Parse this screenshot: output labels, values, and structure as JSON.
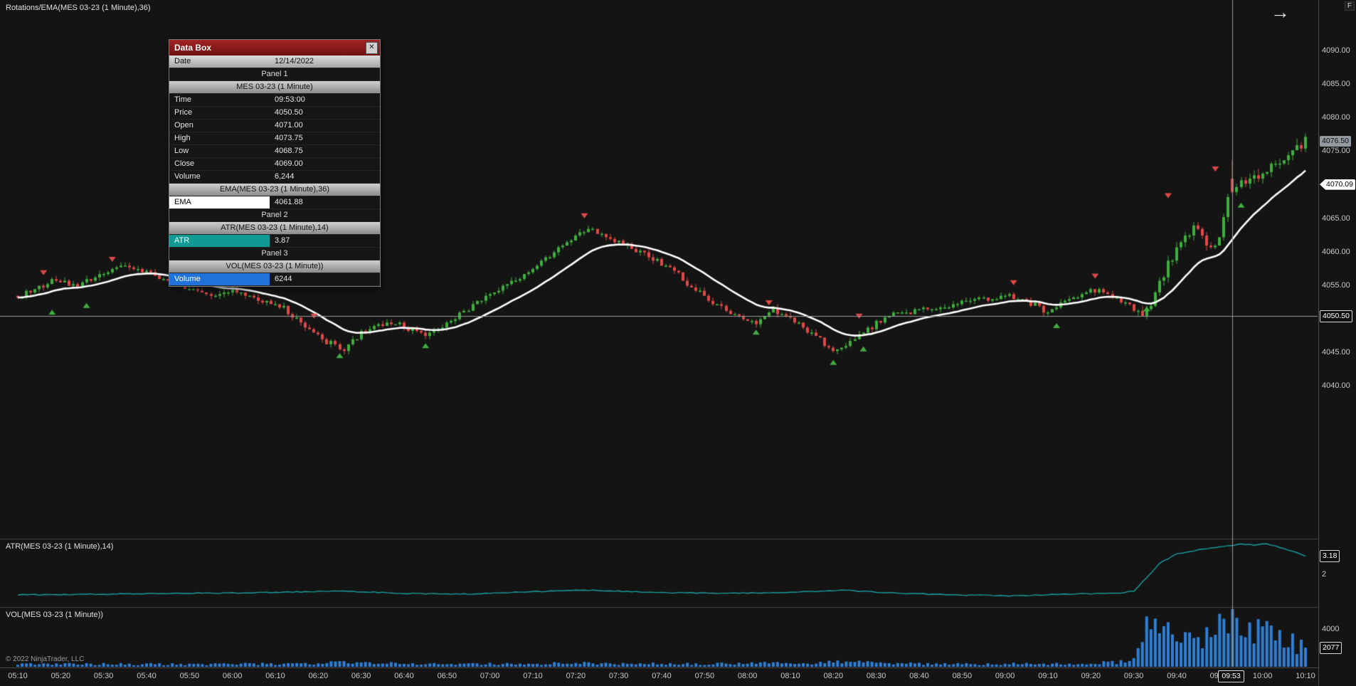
{
  "window": {
    "title": "Rotations/EMA(MES 03-23 (1 Minute),36)",
    "top_right_label": "F",
    "copyright": "© 2022 NinjaTrader, LLC"
  },
  "icons": {
    "close": "✕",
    "arrow_annotation": "→"
  },
  "panels": {
    "atr": {
      "label": "ATR(MES 03-23 (1 Minute),14)"
    },
    "vol": {
      "label": "VOL(MES 03-23 (1 Minute))"
    }
  },
  "data_box": {
    "title": "Data Box",
    "rows": [
      {
        "type": "date",
        "label": "Date",
        "value": "12/14/2022"
      },
      {
        "type": "panel",
        "label": "Panel 1"
      },
      {
        "type": "header",
        "label": "MES 03-23 (1 Minute)"
      },
      {
        "type": "field",
        "label": "Time",
        "value": "09:53:00"
      },
      {
        "type": "field",
        "label": "Price",
        "value": "4050.50"
      },
      {
        "type": "field",
        "label": "Open",
        "value": "4071.00"
      },
      {
        "type": "field",
        "label": "High",
        "value": "4073.75"
      },
      {
        "type": "field",
        "label": "Low",
        "value": "4068.75"
      },
      {
        "type": "field",
        "label": "Close",
        "value": "4069.00"
      },
      {
        "type": "field",
        "label": "Volume",
        "value": "6,244"
      },
      {
        "type": "header",
        "label": "EMA(MES 03-23 (1 Minute),36)"
      },
      {
        "type": "plot",
        "label": "EMA",
        "value": "4061.88",
        "swatch": "#ffffff",
        "text": "#000000"
      },
      {
        "type": "panel",
        "label": "Panel 2"
      },
      {
        "type": "header",
        "label": "ATR(MES 03-23 (1 Minute),14)"
      },
      {
        "type": "plot",
        "label": "ATR",
        "value": "3.87",
        "swatch": "#0f9b94",
        "text": "#ffffff"
      },
      {
        "type": "panel",
        "label": "Panel 3"
      },
      {
        "type": "header",
        "label": "VOL(MES 03-23 (1 Minute))"
      },
      {
        "type": "plot",
        "label": "Volume",
        "value": "6244",
        "swatch": "#1f72d9",
        "text": "#ffffff"
      }
    ]
  },
  "axis": {
    "price_labels": [
      {
        "value": 4090,
        "label": "4090.00"
      },
      {
        "value": 4085,
        "label": "4085.00"
      },
      {
        "value": 4080,
        "label": "4080.00"
      },
      {
        "value": 4075,
        "label": "4075.00"
      },
      {
        "value": 4065,
        "label": "4065.00"
      },
      {
        "value": 4060,
        "label": "4060.00"
      },
      {
        "value": 4055,
        "label": "4055.00"
      },
      {
        "value": 4045,
        "label": "4045.00"
      },
      {
        "value": 4040,
        "label": "4040.00"
      }
    ],
    "atr_labels": [
      {
        "value": 2,
        "label": "2"
      }
    ],
    "vol_labels": [
      {
        "value": 4000,
        "label": "4000"
      }
    ],
    "time_labels": [
      {
        "t": 0,
        "label": "05:10"
      },
      {
        "t": 10,
        "label": "05:20"
      },
      {
        "t": 20,
        "label": "05:30"
      },
      {
        "t": 30,
        "label": "05:40"
      },
      {
        "t": 40,
        "label": "05:50"
      },
      {
        "t": 50,
        "label": "06:00"
      },
      {
        "t": 60,
        "label": "06:10"
      },
      {
        "t": 70,
        "label": "06:20"
      },
      {
        "t": 80,
        "label": "06:30"
      },
      {
        "t": 90,
        "label": "06:40"
      },
      {
        "t": 100,
        "label": "06:50"
      },
      {
        "t": 110,
        "label": "07:00"
      },
      {
        "t": 120,
        "label": "07:10"
      },
      {
        "t": 130,
        "label": "07:20"
      },
      {
        "t": 140,
        "label": "07:30"
      },
      {
        "t": 150,
        "label": "07:40"
      },
      {
        "t": 160,
        "label": "07:50"
      },
      {
        "t": 170,
        "label": "08:00"
      },
      {
        "t": 180,
        "label": "08:10"
      },
      {
        "t": 190,
        "label": "08:20"
      },
      {
        "t": 200,
        "label": "08:30"
      },
      {
        "t": 210,
        "label": "08:40"
      },
      {
        "t": 220,
        "label": "08:50"
      },
      {
        "t": 230,
        "label": "09:00"
      },
      {
        "t": 240,
        "label": "09:10"
      },
      {
        "t": 250,
        "label": "09:20"
      },
      {
        "t": 260,
        "label": "09:30"
      },
      {
        "t": 270,
        "label": "09:40"
      },
      {
        "t": 280,
        "label": "09:50"
      },
      {
        "t": 290,
        "label": "10:00"
      },
      {
        "t": 300,
        "label": "10:10"
      }
    ],
    "markers": {
      "last_price": {
        "value": 4076.5,
        "label": "4076.50"
      },
      "ema": {
        "value": 4070.09,
        "label": "4070.09"
      },
      "crosshair_price": {
        "value": 4050.5,
        "label": "4050.50"
      },
      "atr": {
        "value": 3.18,
        "label": "3.18"
      },
      "volume": {
        "value": 2077,
        "label": "2077"
      },
      "crosshair_time": {
        "t": 283,
        "label": "09:53"
      }
    }
  },
  "chart_data": {
    "type": "candlestick",
    "instrument": "MES 03-23 (1 Minute)",
    "session_start": "05:10",
    "session_end": "10:10",
    "minutes": 300,
    "candle_up_color": "#3fae3f",
    "candle_down_color": "#e04848",
    "crosshair": {
      "t": 283,
      "price": 4050.5,
      "time_label": "09:53"
    },
    "main": {
      "ylim": [
        4017.2,
        4097.7
      ],
      "close_waypoints": [
        [
          0,
          4053.5
        ],
        [
          4,
          4054.5
        ],
        [
          9,
          4056.0
        ],
        [
          13,
          4054.8
        ],
        [
          18,
          4056.2
        ],
        [
          24,
          4058.0
        ],
        [
          28,
          4057.5
        ],
        [
          34,
          4056.0
        ],
        [
          40,
          4054.5
        ],
        [
          44,
          4053.5
        ],
        [
          50,
          4054.5
        ],
        [
          56,
          4053.0
        ],
        [
          60,
          4052.5
        ],
        [
          66,
          4049.5
        ],
        [
          72,
          4046.5
        ],
        [
          76,
          4045.5
        ],
        [
          80,
          4048.0
        ],
        [
          86,
          4049.5
        ],
        [
          90,
          4049.0
        ],
        [
          95,
          4047.5
        ],
        [
          100,
          4049.5
        ],
        [
          106,
          4052.0
        ],
        [
          112,
          4054.5
        ],
        [
          118,
          4056.5
        ],
        [
          124,
          4059.5
        ],
        [
          130,
          4062.5
        ],
        [
          133,
          4063.5
        ],
        [
          137,
          4062.0
        ],
        [
          142,
          4061.0
        ],
        [
          147,
          4059.5
        ],
        [
          152,
          4057.5
        ],
        [
          157,
          4055.0
        ],
        [
          162,
          4052.5
        ],
        [
          167,
          4050.5
        ],
        [
          172,
          4049.5
        ],
        [
          176,
          4051.5
        ],
        [
          181,
          4050.0
        ],
        [
          186,
          4047.5
        ],
        [
          190,
          4045.0
        ],
        [
          194,
          4046.5
        ],
        [
          198,
          4048.5
        ],
        [
          203,
          4050.5
        ],
        [
          208,
          4051.0
        ],
        [
          214,
          4051.5
        ],
        [
          220,
          4052.5
        ],
        [
          226,
          4053.0
        ],
        [
          231,
          4053.5
        ],
        [
          236,
          4052.5
        ],
        [
          240,
          4051.0
        ],
        [
          245,
          4053.0
        ],
        [
          250,
          4054.5
        ],
        [
          255,
          4053.5
        ],
        [
          259,
          4052.0
        ],
        [
          262,
          4050.0
        ],
        [
          265,
          4054.0
        ],
        [
          268,
          4058.0
        ],
        [
          271,
          4061.5
        ],
        [
          274,
          4064.0
        ],
        [
          276,
          4062.5
        ],
        [
          278,
          4060.5
        ],
        [
          280,
          4062.5
        ],
        [
          282,
          4068.0
        ],
        [
          284,
          4070.0
        ],
        [
          287,
          4071.0
        ],
        [
          290,
          4072.0
        ],
        [
          293,
          4073.0
        ],
        [
          296,
          4074.5
        ],
        [
          298,
          4075.5
        ],
        [
          300,
          4076.5
        ]
      ],
      "crosshair_bar": {
        "t": 283,
        "open": 4071.0,
        "high": 4073.75,
        "low": 4068.75,
        "close": 4069.0,
        "volume": 6244
      }
    },
    "ema": {
      "period": 36,
      "draw_period": 18,
      "color": "#ffffff",
      "last_value": 4070.09
    },
    "atr": {
      "period": 14,
      "ylim": [
        0,
        4.2
      ],
      "color": "#1a9e9e",
      "last_value": 3.18,
      "anchors": [
        [
          0,
          0.75
        ],
        [
          20,
          0.8
        ],
        [
          40,
          0.85
        ],
        [
          60,
          0.9
        ],
        [
          75,
          1.0
        ],
        [
          90,
          0.85
        ],
        [
          105,
          0.8
        ],
        [
          120,
          0.95
        ],
        [
          133,
          1.05
        ],
        [
          150,
          0.9
        ],
        [
          165,
          0.85
        ],
        [
          180,
          0.9
        ],
        [
          192,
          1.05
        ],
        [
          205,
          0.85
        ],
        [
          220,
          0.75
        ],
        [
          232,
          0.7
        ],
        [
          245,
          0.8
        ],
        [
          256,
          0.85
        ],
        [
          260,
          1.0
        ],
        [
          263,
          1.8
        ],
        [
          266,
          2.7
        ],
        [
          270,
          3.3
        ],
        [
          274,
          3.5
        ],
        [
          278,
          3.65
        ],
        [
          282,
          3.8
        ],
        [
          285,
          3.9
        ],
        [
          288,
          3.85
        ],
        [
          291,
          3.95
        ],
        [
          294,
          3.7
        ],
        [
          297,
          3.45
        ],
        [
          300,
          3.18
        ]
      ]
    },
    "volume": {
      "ylim": [
        0,
        6400
      ],
      "color": "#2f7fd6",
      "last_value": 2077,
      "anchors": [
        [
          0,
          280
        ],
        [
          20,
          300
        ],
        [
          40,
          260
        ],
        [
          60,
          320
        ],
        [
          75,
          430
        ],
        [
          90,
          330
        ],
        [
          110,
          300
        ],
        [
          130,
          390
        ],
        [
          150,
          310
        ],
        [
          170,
          360
        ],
        [
          185,
          430
        ],
        [
          195,
          520
        ],
        [
          205,
          360
        ],
        [
          220,
          290
        ],
        [
          235,
          310
        ],
        [
          250,
          380
        ],
        [
          258,
          520
        ],
        [
          261,
          1400
        ],
        [
          263,
          3800
        ],
        [
          266,
          4300
        ],
        [
          269,
          3700
        ],
        [
          272,
          4600
        ],
        [
          275,
          3400
        ],
        [
          278,
          4000
        ],
        [
          281,
          4500
        ],
        [
          283,
          5600
        ],
        [
          285,
          4200
        ],
        [
          288,
          3600
        ],
        [
          291,
          3900
        ],
        [
          294,
          3100
        ],
        [
          297,
          2600
        ],
        [
          300,
          2077
        ]
      ]
    },
    "signals": {
      "down_color": "#e04848",
      "up_color": "#3fae3f",
      "down": [
        [
          6,
          4057.0
        ],
        [
          22,
          4059.0
        ],
        [
          42,
          4056.0
        ],
        [
          69,
          4050.5
        ],
        [
          132,
          4065.5
        ],
        [
          175,
          4052.5
        ],
        [
          196,
          4050.5
        ],
        [
          232,
          4055.5
        ],
        [
          251,
          4056.5
        ],
        [
          268,
          4068.5
        ],
        [
          279,
          4072.5
        ]
      ],
      "up": [
        [
          8,
          4051.0
        ],
        [
          16,
          4052.0
        ],
        [
          75,
          4044.5
        ],
        [
          95,
          4046.0
        ],
        [
          172,
          4048.0
        ],
        [
          190,
          4043.5
        ],
        [
          197,
          4045.5
        ],
        [
          242,
          4049.0
        ],
        [
          263,
          4051.5
        ],
        [
          285,
          4067.0
        ]
      ]
    }
  }
}
